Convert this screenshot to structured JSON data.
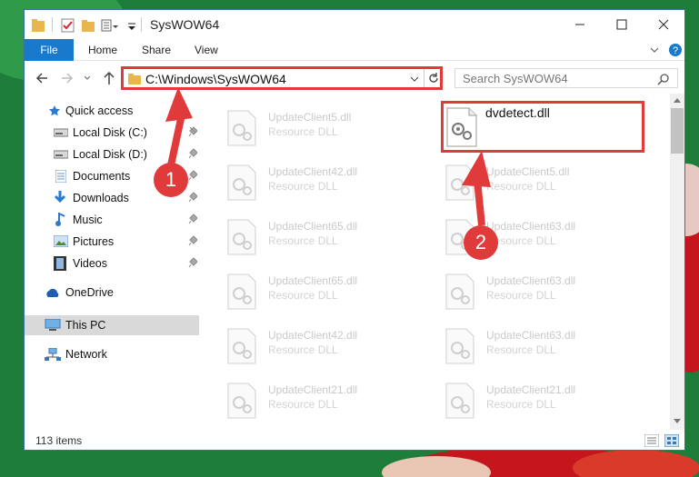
{
  "window": {
    "title": "SysWOW64"
  },
  "ribbon": {
    "tabs": [
      "File",
      "Home",
      "Share",
      "View"
    ]
  },
  "address": {
    "path": "C:\\Windows\\SysWOW64"
  },
  "search": {
    "placeholder": "Search SysWOW64"
  },
  "nav": {
    "items": [
      {
        "label": "Quick access",
        "icon": "star-icon",
        "pinned": false
      },
      {
        "label": "Local Disk (C:)",
        "icon": "drive-icon",
        "pinned": true
      },
      {
        "label": "Local Disk (D:)",
        "icon": "drive-icon",
        "pinned": true
      },
      {
        "label": "Documents",
        "icon": "documents-icon",
        "pinned": true
      },
      {
        "label": "Downloads",
        "icon": "download-icon",
        "pinned": true
      },
      {
        "label": "Music",
        "icon": "music-icon",
        "pinned": true
      },
      {
        "label": "Pictures",
        "icon": "pictures-icon",
        "pinned": true
      },
      {
        "label": "Videos",
        "icon": "videos-icon",
        "pinned": true
      },
      {
        "label": "OneDrive",
        "icon": "cloud-icon",
        "pinned": false
      },
      {
        "label": "This PC",
        "icon": "computer-icon",
        "pinned": false,
        "selected": true
      },
      {
        "label": "Network",
        "icon": "network-icon",
        "pinned": false
      }
    ]
  },
  "files": {
    "left": [
      {
        "name": "UpdateClient5.dll",
        "type": "Resource DLL"
      },
      {
        "name": "UpdateClient42.dll",
        "type": "Resource DLL"
      },
      {
        "name": "UpdateClient65.dll",
        "type": "Resource DLL"
      },
      {
        "name": "UpdateClient65.dll",
        "type": "Resource DLL"
      },
      {
        "name": "UpdateClient42.dll",
        "type": "Resource DLL"
      },
      {
        "name": "UpdateClient21.dll",
        "type": "Resource DLL"
      }
    ],
    "right": [
      {
        "name": "UpdateClient5.dll",
        "type": "Resource DLL"
      },
      {
        "name": "UpdateClient63.dll",
        "type": "Resource DLL"
      },
      {
        "name": "UpdateClient63.dll",
        "type": "Resource DLL"
      },
      {
        "name": "UpdateClient63.dll",
        "type": "Resource DLL"
      },
      {
        "name": "UpdateClient21.dll",
        "type": "Resource DLL"
      }
    ],
    "highlighted": {
      "name": "dvdetect.dll"
    }
  },
  "status": {
    "count": "113 items"
  },
  "annotations": {
    "step1": "1",
    "step2": "2"
  },
  "colors": {
    "accent": "#1979ca",
    "highlight": "#e03a3a"
  }
}
